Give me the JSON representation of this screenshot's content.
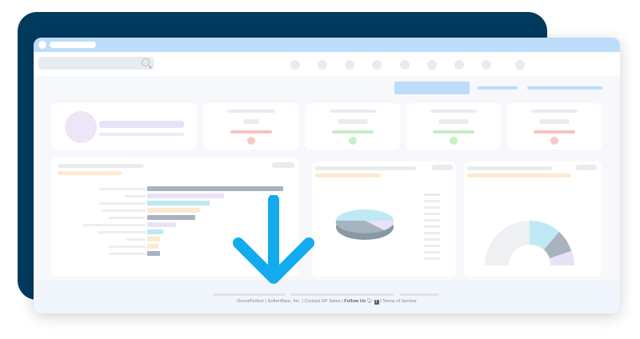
{
  "footer": {
    "company": "DonorPerfect",
    "vendor": "SofterWare, Inc.",
    "contact": "Contact DP Sales",
    "follow": "Follow Us",
    "terms": "Terms of Service",
    "sep": "|"
  },
  "colors": {
    "navy": "#023a5e",
    "accent_light_blue": "#bcdcf9",
    "arrow_blue": "#13aaee",
    "red_indicator": "#f4c2c1",
    "green_indicator": "#c5ecc4",
    "purple": "#e9e2f7",
    "teal": "#bde9f3",
    "slate": "#a7b3bf",
    "peach": "#fde9d0"
  },
  "icons": [
    "search-icon",
    "twitter-icon",
    "facebook-icon",
    "down-arrow-icon"
  ]
}
